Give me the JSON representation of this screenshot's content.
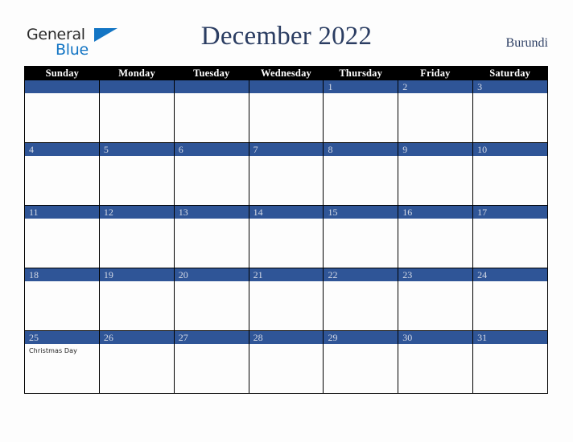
{
  "brand": {
    "name_part1": "General",
    "name_part2": "Blue",
    "triangle_color": "#1375c4",
    "text_color": "#2b2b2b"
  },
  "header": {
    "title": "December 2022",
    "country": "Burundi",
    "title_color": "#2b3d62"
  },
  "calendar": {
    "month": "December",
    "year": "2022",
    "accent_color": "#2f5597",
    "header_band_color": "#000000",
    "day_number_color": "#d5dae6",
    "weekdays": [
      "Sunday",
      "Monday",
      "Tuesday",
      "Wednesday",
      "Thursday",
      "Friday",
      "Saturday"
    ],
    "weeks": [
      [
        {
          "date": "",
          "event": ""
        },
        {
          "date": "",
          "event": ""
        },
        {
          "date": "",
          "event": ""
        },
        {
          "date": "",
          "event": ""
        },
        {
          "date": "1",
          "event": ""
        },
        {
          "date": "2",
          "event": ""
        },
        {
          "date": "3",
          "event": ""
        }
      ],
      [
        {
          "date": "4",
          "event": ""
        },
        {
          "date": "5",
          "event": ""
        },
        {
          "date": "6",
          "event": ""
        },
        {
          "date": "7",
          "event": ""
        },
        {
          "date": "8",
          "event": ""
        },
        {
          "date": "9",
          "event": ""
        },
        {
          "date": "10",
          "event": ""
        }
      ],
      [
        {
          "date": "11",
          "event": ""
        },
        {
          "date": "12",
          "event": ""
        },
        {
          "date": "13",
          "event": ""
        },
        {
          "date": "14",
          "event": ""
        },
        {
          "date": "15",
          "event": ""
        },
        {
          "date": "16",
          "event": ""
        },
        {
          "date": "17",
          "event": ""
        }
      ],
      [
        {
          "date": "18",
          "event": ""
        },
        {
          "date": "19",
          "event": ""
        },
        {
          "date": "20",
          "event": ""
        },
        {
          "date": "21",
          "event": ""
        },
        {
          "date": "22",
          "event": ""
        },
        {
          "date": "23",
          "event": ""
        },
        {
          "date": "24",
          "event": ""
        }
      ],
      [
        {
          "date": "25",
          "event": "Christmas Day"
        },
        {
          "date": "26",
          "event": ""
        },
        {
          "date": "27",
          "event": ""
        },
        {
          "date": "28",
          "event": ""
        },
        {
          "date": "29",
          "event": ""
        },
        {
          "date": "30",
          "event": ""
        },
        {
          "date": "31",
          "event": ""
        }
      ]
    ]
  }
}
